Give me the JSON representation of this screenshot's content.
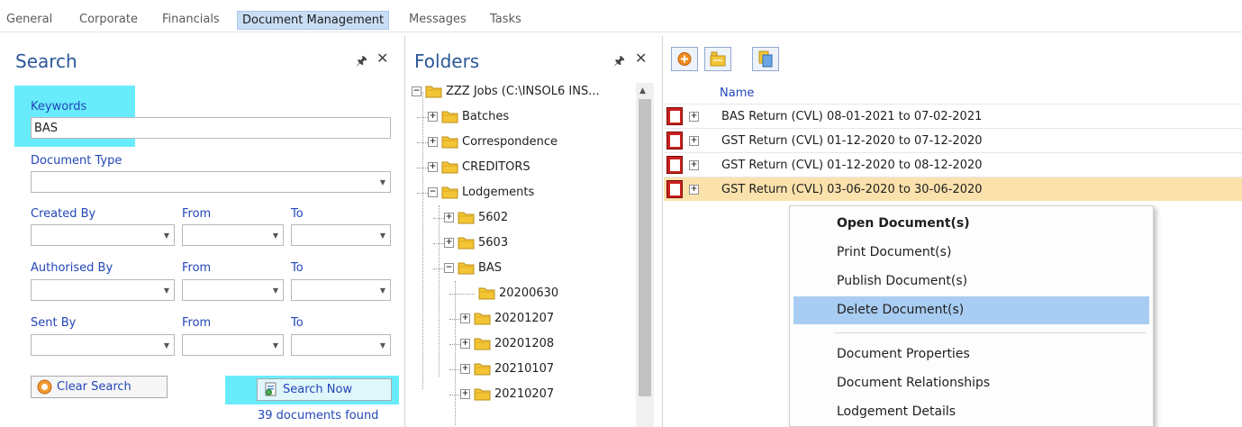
{
  "tabs": [
    "General",
    "Corporate",
    "Financials",
    "Document Management",
    "Messages",
    "Tasks"
  ],
  "active_tab": "Document Management",
  "search_panel": {
    "title": "Search",
    "keywords_label": "Keywords",
    "keywords_value": "BAS",
    "document_type_label": "Document Type",
    "created_by_label": "Created By",
    "authorised_by_label": "Authorised By",
    "sent_by_label": "Sent By",
    "from_label": "From",
    "to_label": "To",
    "clear_search_label": "Clear Search",
    "search_now_label": "Search Now",
    "result_count": "39 documents found"
  },
  "folders_panel": {
    "title": "Folders",
    "items": [
      {
        "label": "ZZZ Jobs (C:\\INSOL6 INS...",
        "level": 0,
        "expander": "−"
      },
      {
        "label": "Batches",
        "level": 1,
        "expander": "+"
      },
      {
        "label": "Correspondence",
        "level": 1,
        "expander": "+"
      },
      {
        "label": "CREDITORS",
        "level": 1,
        "expander": "+"
      },
      {
        "label": "Lodgements",
        "level": 1,
        "expander": "−"
      },
      {
        "label": "5602",
        "level": 2,
        "expander": "+"
      },
      {
        "label": "5603",
        "level": 2,
        "expander": "+"
      },
      {
        "label": "BAS",
        "level": 2,
        "expander": "−"
      },
      {
        "label": "20200630",
        "level": 3,
        "expander": ""
      },
      {
        "label": "20201207",
        "level": 3,
        "expander": "+"
      },
      {
        "label": "20201208",
        "level": 3,
        "expander": "+"
      },
      {
        "label": "20210107",
        "level": 3,
        "expander": "+"
      },
      {
        "label": "20210207",
        "level": 3,
        "expander": "+"
      }
    ]
  },
  "documents_panel": {
    "toolbar": [
      "add-icon",
      "open-folder-icon",
      "attach-documents-icon"
    ],
    "column_name": "Name",
    "rows": [
      "BAS Return (CVL) 08-01-2021 to 07-02-2021",
      "GST Return (CVL) 01-12-2020 to 07-12-2020",
      "GST Return (CVL) 01-12-2020 to 08-12-2020",
      "GST Return (CVL) 03-06-2020 to 30-06-2020"
    ],
    "selected_row": "GST Return (CVL) 03-06-2020 to 30-06-2020"
  },
  "context_menu": {
    "items": [
      "Open Document(s)",
      "Print Document(s)",
      "Publish Document(s)",
      "Delete Document(s)",
      "Document Properties",
      "Document Relationships",
      "Lodgement Details"
    ],
    "hovered": "Delete Document(s)"
  },
  "colors": {
    "accent_blue": "#2b5797",
    "label_blue": "#2346b8",
    "highlight_cyan": "#68ecfc",
    "selected_row": "#fbe2ad",
    "menu_hover": "#a9cdf2",
    "folder_yellow": "#f3c534",
    "pdf_red": "#c9211e"
  }
}
